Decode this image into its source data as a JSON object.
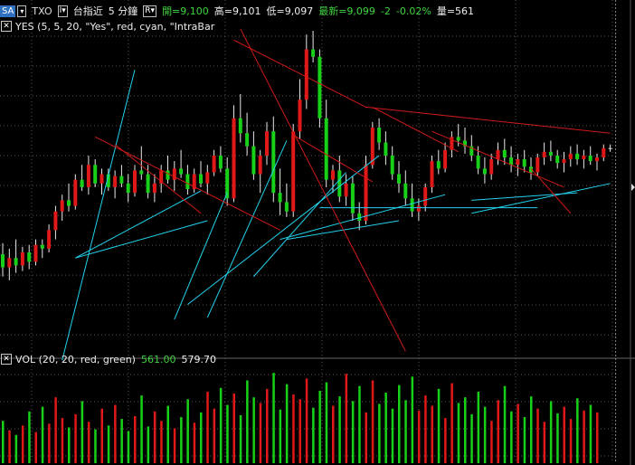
{
  "header": {
    "contract_button": "SA",
    "symbol": "TXO",
    "symbol_box": "I▾",
    "name": "台指近",
    "period": "5 分鐘",
    "r_box": "R▾",
    "open": "開=9,100",
    "high": "高=9,101",
    "low": "低=9,097",
    "last": "最新=9,099",
    "change": "-2",
    "change_pct": "-0.02%",
    "volume": "量=561"
  },
  "indicator_price": {
    "close_label": "✕",
    "text": "YES (5, 5, 20, \"Yes\", red, cyan, \"IntraBar"
  },
  "indicator_volume": {
    "close_label": "✕",
    "label": "VOL (20, 20, red, green)",
    "value1": "561.00",
    "value2": "579.70"
  },
  "colors": {
    "up": "#e01818",
    "down": "#18d018",
    "neutral": "#dddddd",
    "grid": "#555555",
    "cyan": "#22d3ee",
    "red_line": "#d01a1a",
    "background": "#000000"
  },
  "chart_data": {
    "type": "candlestick",
    "price_series": [
      [
        9042,
        9048,
        9030,
        9035
      ],
      [
        9035,
        9045,
        9028,
        9040
      ],
      [
        9040,
        9050,
        9032,
        9036
      ],
      [
        9036,
        9046,
        9033,
        9043
      ],
      [
        9043,
        9047,
        9034,
        9038
      ],
      [
        9038,
        9050,
        9036,
        9047
      ],
      [
        9047,
        9050,
        9040,
        9045
      ],
      [
        9045,
        9058,
        9043,
        9055
      ],
      [
        9055,
        9068,
        9050,
        9065
      ],
      [
        9065,
        9074,
        9060,
        9071
      ],
      [
        9071,
        9080,
        9065,
        9068
      ],
      [
        9068,
        9085,
        9066,
        9082
      ],
      [
        9082,
        9090,
        9076,
        9078
      ],
      [
        9078,
        9095,
        9074,
        9090
      ],
      [
        9090,
        9093,
        9078,
        9080
      ],
      [
        9080,
        9088,
        9074,
        9085
      ],
      [
        9085,
        9088,
        9076,
        9078
      ],
      [
        9078,
        9087,
        9072,
        9084
      ],
      [
        9084,
        9090,
        9078,
        9080
      ],
      [
        9080,
        9085,
        9070,
        9075
      ],
      [
        9075,
        9090,
        9073,
        9087
      ],
      [
        9087,
        9100,
        9082,
        9085
      ],
      [
        9085,
        9090,
        9072,
        9075
      ],
      [
        9075,
        9085,
        9070,
        9080
      ],
      [
        9080,
        9090,
        9075,
        9087
      ],
      [
        9087,
        9095,
        9080,
        9082
      ],
      [
        9082,
        9092,
        9076,
        9088
      ],
      [
        9088,
        9098,
        9083,
        9085
      ],
      [
        9085,
        9090,
        9074,
        9077
      ],
      [
        9077,
        9088,
        9075,
        9085
      ],
      [
        9085,
        9092,
        9078,
        9080
      ],
      [
        9080,
        9090,
        9074,
        9086
      ],
      [
        9086,
        9098,
        9084,
        9095
      ],
      [
        9095,
        9100,
        9086,
        9088
      ],
      [
        9088,
        9094,
        9068,
        9072
      ],
      [
        9072,
        9122,
        9070,
        9115
      ],
      [
        9115,
        9128,
        9102,
        9107
      ],
      [
        9107,
        9118,
        9095,
        9100
      ],
      [
        9100,
        9108,
        9082,
        9085
      ],
      [
        9085,
        9098,
        9075,
        9095
      ],
      [
        9095,
        9113,
        9090,
        9108
      ],
      [
        9108,
        9116,
        9070,
        9075
      ],
      [
        9075,
        9088,
        9063,
        9070
      ],
      [
        9070,
        9080,
        9062,
        9065
      ],
      [
        9065,
        9112,
        9062,
        9108
      ],
      [
        9108,
        9136,
        9104,
        9125
      ],
      [
        9125,
        9160,
        9120,
        9152
      ],
      [
        9152,
        9162,
        9145,
        9148
      ],
      [
        9148,
        9152,
        9110,
        9115
      ],
      [
        9115,
        9125,
        9078,
        9082
      ],
      [
        9082,
        9090,
        9075,
        9087
      ],
      [
        9087,
        9095,
        9070,
        9073
      ],
      [
        9073,
        9085,
        9068,
        9080
      ],
      [
        9080,
        9084,
        9060,
        9064
      ],
      [
        9064,
        9070,
        9055,
        9060
      ],
      [
        9060,
        9095,
        9058,
        9090
      ],
      [
        9090,
        9113,
        9088,
        9110
      ],
      [
        9110,
        9115,
        9098,
        9102
      ],
      [
        9102,
        9108,
        9090,
        9095
      ],
      [
        9095,
        9100,
        9082,
        9085
      ],
      [
        9085,
        9092,
        9075,
        9080
      ],
      [
        9080,
        9087,
        9068,
        9072
      ],
      [
        9072,
        9080,
        9062,
        9065
      ],
      [
        9065,
        9072,
        9060,
        9068
      ],
      [
        9068,
        9080,
        9065,
        9078
      ],
      [
        9078,
        9095,
        9075,
        9092
      ],
      [
        9092,
        9098,
        9085,
        9088
      ],
      [
        9088,
        9102,
        9086,
        9098
      ],
      [
        9098,
        9108,
        9094,
        9105
      ],
      [
        9105,
        9112,
        9100,
        9103
      ],
      [
        9103,
        9110,
        9096,
        9100
      ],
      [
        9100,
        9106,
        9092,
        9095
      ],
      [
        9095,
        9100,
        9085,
        9088
      ],
      [
        9088,
        9094,
        9080,
        9085
      ],
      [
        9085,
        9096,
        9082,
        9093
      ],
      [
        9093,
        9102,
        9090,
        9098
      ],
      [
        9098,
        9104,
        9090,
        9094
      ],
      [
        9094,
        9100,
        9086,
        9090
      ],
      [
        9090,
        9096,
        9084,
        9093
      ],
      [
        9093,
        9098,
        9086,
        9089
      ],
      [
        9089,
        9094,
        9082,
        9086
      ],
      [
        9086,
        9096,
        9084,
        9094
      ],
      [
        9094,
        9102,
        9090,
        9097
      ],
      [
        9097,
        9103,
        9092,
        9095
      ],
      [
        9095,
        9098,
        9088,
        9091
      ],
      [
        9091,
        9097,
        9086,
        9093
      ],
      [
        9093,
        9100,
        9089,
        9096
      ],
      [
        9096,
        9101,
        9090,
        9093
      ],
      [
        9093,
        9098,
        9088,
        9095
      ],
      [
        9095,
        9100,
        9090,
        9092
      ],
      [
        9092,
        9096,
        9087,
        9094
      ],
      [
        9094,
        9101,
        9092,
        9099
      ],
      [
        9099,
        9101,
        9097,
        9099
      ]
    ],
    "volume_series": [
      45,
      35,
      30,
      40,
      55,
      33,
      60,
      42,
      70,
      48,
      38,
      52,
      66,
      44,
      36,
      58,
      40,
      62,
      47,
      34,
      50,
      72,
      39,
      55,
      45,
      61,
      37,
      49,
      68,
      43,
      54,
      76,
      58,
      80,
      62,
      74,
      51,
      88,
      70,
      64,
      79,
      96,
      57,
      84,
      73,
      68,
      90,
      59,
      77,
      86,
      61,
      71,
      95,
      66,
      82,
      54,
      88,
      63,
      75,
      58,
      83,
      67,
      92,
      56,
      72,
      61,
      79,
      48,
      85,
      64,
      70,
      52,
      76,
      60,
      45,
      67,
      82,
      55,
      63,
      49,
      71,
      58,
      44,
      66,
      53,
      60,
      47,
      69,
      56,
      62,
      54
    ],
    "price_range": [
      8992,
      9162
    ],
    "volume_range": [
      0,
      100
    ],
    "drawn_lines": {
      "cyan": [
        [
          9,
          8985,
          20,
          9141
        ],
        [
          11,
          9040,
          30,
          9076
        ],
        [
          11,
          9040,
          31,
          9060
        ],
        [
          28,
          9015,
          57,
          9095
        ],
        [
          26,
          9007,
          34,
          9075
        ],
        [
          31,
          9008,
          43,
          9103
        ],
        [
          38,
          9030,
          52,
          9086
        ],
        [
          42,
          9050,
          67,
          9074
        ],
        [
          43,
          9050,
          60,
          9060
        ],
        [
          48,
          9067,
          81,
          9067
        ],
        [
          71,
          9071,
          87,
          9075
        ],
        [
          71,
          9064,
          92,
          9080
        ]
      ],
      "red": [
        [
          14,
          9105,
          42,
          9055
        ],
        [
          17,
          9101,
          30,
          9064
        ],
        [
          36,
          9163,
          61,
          8990
        ],
        [
          35,
          9157,
          55,
          9121
        ],
        [
          55,
          9121,
          92,
          9107
        ],
        [
          44,
          9106,
          56,
          9081
        ],
        [
          56,
          9121,
          69,
          9097
        ],
        [
          65,
          9108,
          85,
          9078
        ],
        [
          80,
          9088,
          86,
          9064
        ]
      ]
    },
    "grid": true
  }
}
